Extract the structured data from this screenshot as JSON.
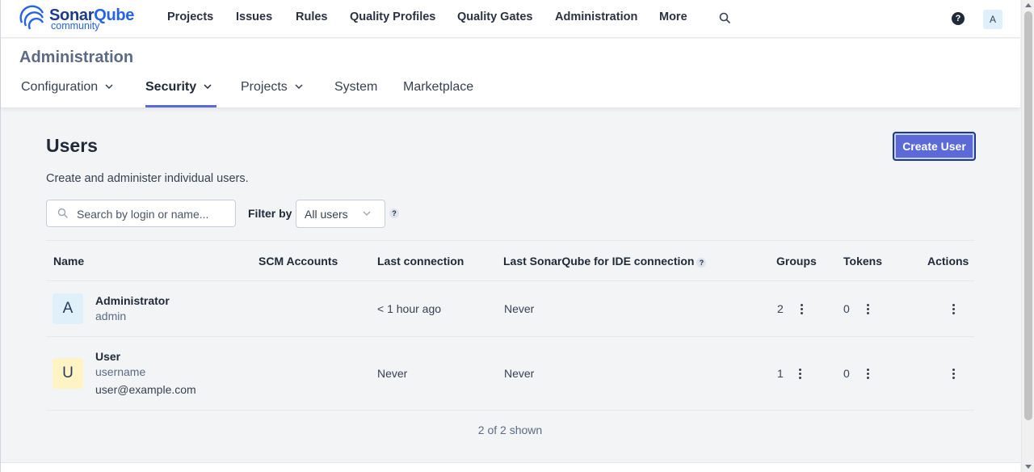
{
  "brand": {
    "name_part1": "Sonar",
    "name_part2": "Qube",
    "edition": "community"
  },
  "nav": {
    "items": [
      "Projects",
      "Issues",
      "Rules",
      "Quality Profiles",
      "Quality Gates",
      "Administration",
      "More"
    ],
    "help": "?",
    "avatar_letter": "A"
  },
  "admin": {
    "title": "Administration",
    "tabs": [
      {
        "label": "Configuration",
        "dropdown": true
      },
      {
        "label": "Security",
        "dropdown": true,
        "active": true
      },
      {
        "label": "Projects",
        "dropdown": true
      },
      {
        "label": "System",
        "dropdown": false
      },
      {
        "label": "Marketplace",
        "dropdown": false
      }
    ]
  },
  "users": {
    "title": "Users",
    "description": "Create and administer individual users.",
    "create_button": "Create User",
    "search_placeholder": "Search by login or name...",
    "filter_label": "Filter by",
    "filter_value": "All users",
    "filter_help": "?",
    "columns": [
      "Name",
      "SCM Accounts",
      "Last connection",
      "Last SonarQube for IDE connection",
      "Groups",
      "Tokens",
      "Actions"
    ],
    "ide_help": "?",
    "rows": [
      {
        "avatar_letter": "A",
        "name": "Administrator",
        "login": "admin",
        "email": "",
        "last_connection": "< 1 hour ago",
        "last_ide_connection": "Never",
        "groups": "2",
        "tokens": "0"
      },
      {
        "avatar_letter": "U",
        "name": "User",
        "login": "username",
        "email": "user@example.com",
        "last_connection": "Never",
        "last_ide_connection": "Never",
        "groups": "1",
        "tokens": "0"
      }
    ],
    "shown": "2 of 2 shown"
  },
  "colors": {
    "accent": "#5c6ad8",
    "avatar_admin_bg": "#e0f0fb",
    "avatar_user_bg": "#fdf3c4"
  }
}
